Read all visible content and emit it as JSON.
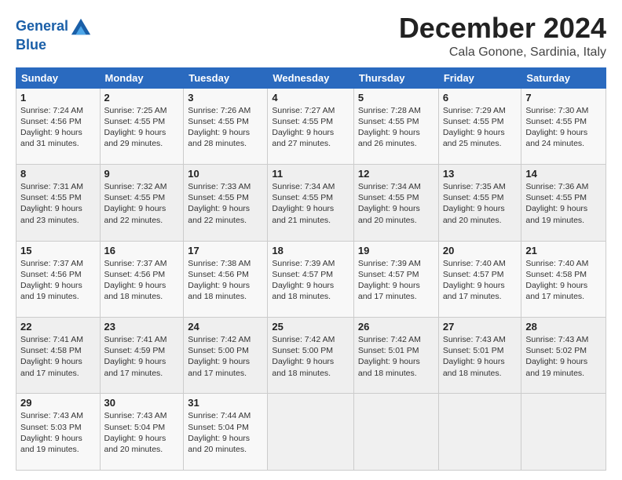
{
  "logo": {
    "line1": "General",
    "line2": "Blue"
  },
  "title": "December 2024",
  "location": "Cala Gonone, Sardinia, Italy",
  "weekdays": [
    "Sunday",
    "Monday",
    "Tuesday",
    "Wednesday",
    "Thursday",
    "Friday",
    "Saturday"
  ],
  "weeks": [
    [
      {
        "day": "1",
        "info": "Sunrise: 7:24 AM\nSunset: 4:56 PM\nDaylight: 9 hours\nand 31 minutes."
      },
      {
        "day": "2",
        "info": "Sunrise: 7:25 AM\nSunset: 4:55 PM\nDaylight: 9 hours\nand 29 minutes."
      },
      {
        "day": "3",
        "info": "Sunrise: 7:26 AM\nSunset: 4:55 PM\nDaylight: 9 hours\nand 28 minutes."
      },
      {
        "day": "4",
        "info": "Sunrise: 7:27 AM\nSunset: 4:55 PM\nDaylight: 9 hours\nand 27 minutes."
      },
      {
        "day": "5",
        "info": "Sunrise: 7:28 AM\nSunset: 4:55 PM\nDaylight: 9 hours\nand 26 minutes."
      },
      {
        "day": "6",
        "info": "Sunrise: 7:29 AM\nSunset: 4:55 PM\nDaylight: 9 hours\nand 25 minutes."
      },
      {
        "day": "7",
        "info": "Sunrise: 7:30 AM\nSunset: 4:55 PM\nDaylight: 9 hours\nand 24 minutes."
      }
    ],
    [
      {
        "day": "8",
        "info": "Sunrise: 7:31 AM\nSunset: 4:55 PM\nDaylight: 9 hours\nand 23 minutes."
      },
      {
        "day": "9",
        "info": "Sunrise: 7:32 AM\nSunset: 4:55 PM\nDaylight: 9 hours\nand 22 minutes."
      },
      {
        "day": "10",
        "info": "Sunrise: 7:33 AM\nSunset: 4:55 PM\nDaylight: 9 hours\nand 22 minutes."
      },
      {
        "day": "11",
        "info": "Sunrise: 7:34 AM\nSunset: 4:55 PM\nDaylight: 9 hours\nand 21 minutes."
      },
      {
        "day": "12",
        "info": "Sunrise: 7:34 AM\nSunset: 4:55 PM\nDaylight: 9 hours\nand 20 minutes."
      },
      {
        "day": "13",
        "info": "Sunrise: 7:35 AM\nSunset: 4:55 PM\nDaylight: 9 hours\nand 20 minutes."
      },
      {
        "day": "14",
        "info": "Sunrise: 7:36 AM\nSunset: 4:55 PM\nDaylight: 9 hours\nand 19 minutes."
      }
    ],
    [
      {
        "day": "15",
        "info": "Sunrise: 7:37 AM\nSunset: 4:56 PM\nDaylight: 9 hours\nand 19 minutes."
      },
      {
        "day": "16",
        "info": "Sunrise: 7:37 AM\nSunset: 4:56 PM\nDaylight: 9 hours\nand 18 minutes."
      },
      {
        "day": "17",
        "info": "Sunrise: 7:38 AM\nSunset: 4:56 PM\nDaylight: 9 hours\nand 18 minutes."
      },
      {
        "day": "18",
        "info": "Sunrise: 7:39 AM\nSunset: 4:57 PM\nDaylight: 9 hours\nand 18 minutes."
      },
      {
        "day": "19",
        "info": "Sunrise: 7:39 AM\nSunset: 4:57 PM\nDaylight: 9 hours\nand 17 minutes."
      },
      {
        "day": "20",
        "info": "Sunrise: 7:40 AM\nSunset: 4:57 PM\nDaylight: 9 hours\nand 17 minutes."
      },
      {
        "day": "21",
        "info": "Sunrise: 7:40 AM\nSunset: 4:58 PM\nDaylight: 9 hours\nand 17 minutes."
      }
    ],
    [
      {
        "day": "22",
        "info": "Sunrise: 7:41 AM\nSunset: 4:58 PM\nDaylight: 9 hours\nand 17 minutes."
      },
      {
        "day": "23",
        "info": "Sunrise: 7:41 AM\nSunset: 4:59 PM\nDaylight: 9 hours\nand 17 minutes."
      },
      {
        "day": "24",
        "info": "Sunrise: 7:42 AM\nSunset: 5:00 PM\nDaylight: 9 hours\nand 17 minutes."
      },
      {
        "day": "25",
        "info": "Sunrise: 7:42 AM\nSunset: 5:00 PM\nDaylight: 9 hours\nand 18 minutes."
      },
      {
        "day": "26",
        "info": "Sunrise: 7:42 AM\nSunset: 5:01 PM\nDaylight: 9 hours\nand 18 minutes."
      },
      {
        "day": "27",
        "info": "Sunrise: 7:43 AM\nSunset: 5:01 PM\nDaylight: 9 hours\nand 18 minutes."
      },
      {
        "day": "28",
        "info": "Sunrise: 7:43 AM\nSunset: 5:02 PM\nDaylight: 9 hours\nand 19 minutes."
      }
    ],
    [
      {
        "day": "29",
        "info": "Sunrise: 7:43 AM\nSunset: 5:03 PM\nDaylight: 9 hours\nand 19 minutes."
      },
      {
        "day": "30",
        "info": "Sunrise: 7:43 AM\nSunset: 5:04 PM\nDaylight: 9 hours\nand 20 minutes."
      },
      {
        "day": "31",
        "info": "Sunrise: 7:44 AM\nSunset: 5:04 PM\nDaylight: 9 hours\nand 20 minutes."
      },
      null,
      null,
      null,
      null
    ]
  ]
}
